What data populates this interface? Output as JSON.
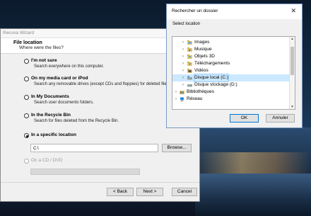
{
  "wizard": {
    "title": "Recuva Wizard",
    "header_title": "File location",
    "header_subtitle": "Where were the files?",
    "options": [
      {
        "label": "I'm not sure",
        "desc": "Search everywhere on this computer.",
        "selected": false
      },
      {
        "label": "On my media card or iPod",
        "desc": "Search any removable drives (except CDs and floppies) for deleted files.",
        "selected": false
      },
      {
        "label": "In My Documents",
        "desc": "Search user documents folders.",
        "selected": false
      },
      {
        "label": "In the Recycle Bin",
        "desc": "Search for files deleted from the Recycle Bin.",
        "selected": false
      },
      {
        "label": "In a specific location",
        "desc": "",
        "selected": true
      },
      {
        "label": "On a CD / DVD",
        "desc": "",
        "selected": false,
        "disabled": true
      }
    ],
    "path_value": "C:\\",
    "browse_label": "Browse...",
    "back_label": "< Back",
    "next_label": "Next >",
    "cancel_label": "Cancel"
  },
  "dialog": {
    "title": "Rechercher un dossier",
    "close_glyph": "✕",
    "subtitle": "Select location",
    "tree": [
      {
        "label": "Images",
        "icon": "pictures-folder-icon",
        "indent": 1,
        "expander": true
      },
      {
        "label": "Musique",
        "icon": "music-folder-icon",
        "indent": 1,
        "expander": true
      },
      {
        "label": "Objets 3D",
        "icon": "3d-objects-folder-icon",
        "indent": 1,
        "expander": true
      },
      {
        "label": "Téléchargements",
        "icon": "downloads-folder-icon",
        "indent": 1,
        "expander": true
      },
      {
        "label": "Vidéos",
        "icon": "videos-folder-icon",
        "indent": 1,
        "expander": true
      },
      {
        "label": "Disque local (C:)",
        "icon": "drive-c-icon",
        "indent": 1,
        "expander": true,
        "selected": true
      },
      {
        "label": "Disque stockage (D:)",
        "icon": "drive-d-icon",
        "indent": 1,
        "expander": true
      },
      {
        "label": "Bibliothèques",
        "icon": "libraries-icon",
        "indent": 0,
        "expander": true
      },
      {
        "label": "Réseau",
        "icon": "network-icon",
        "indent": 0,
        "expander": true
      }
    ],
    "ok_label": "OK",
    "cancel_label": "Annuler",
    "selection_color": "#cce8ff"
  }
}
